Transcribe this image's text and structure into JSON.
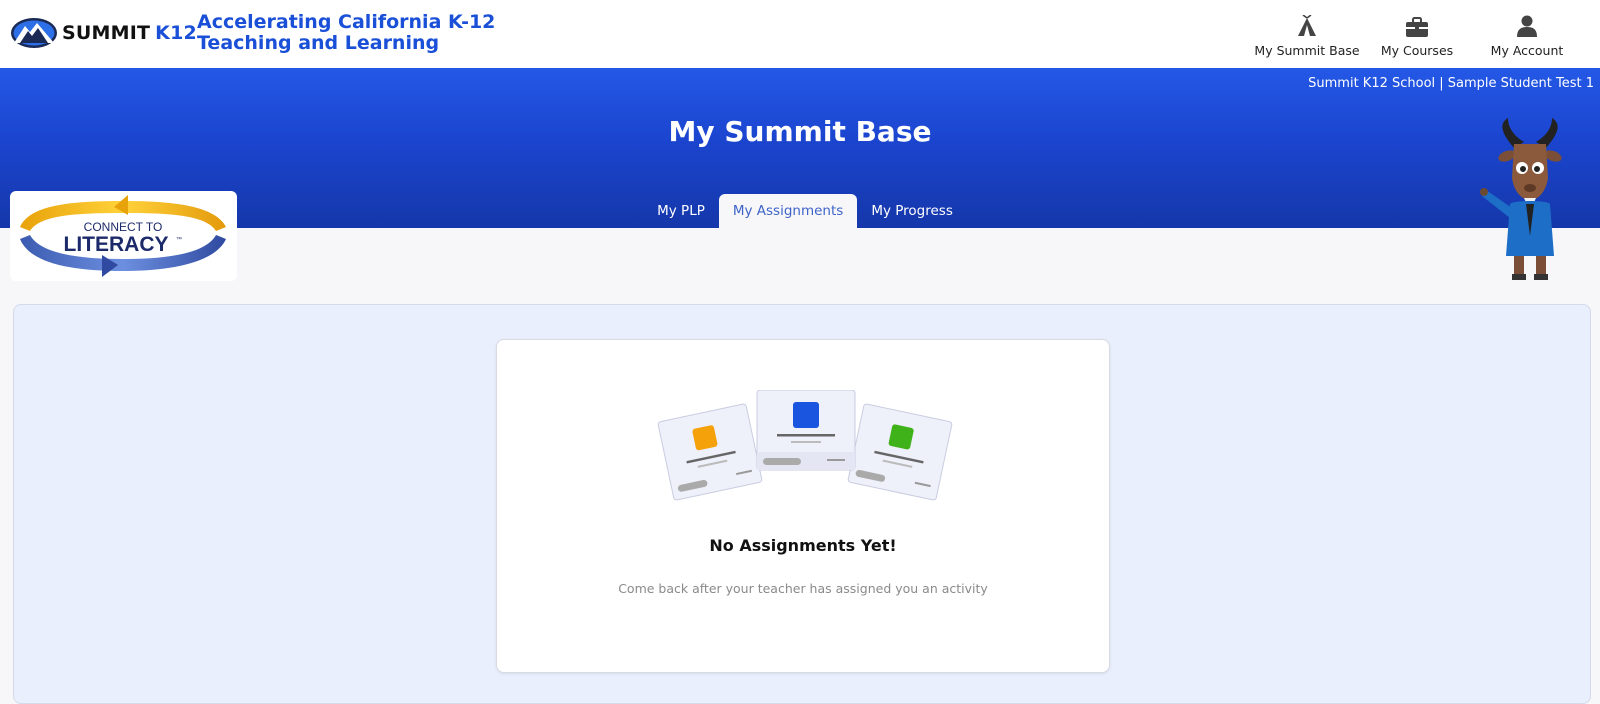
{
  "brand": {
    "name": "SUMMIT",
    "suffix": "K12",
    "tagline_line1": "Accelerating California K-12",
    "tagline_line2": "Teaching and Learning",
    "icon": "mountain-logo-icon"
  },
  "topnav": {
    "items": [
      {
        "label": "My Summit Base",
        "icon": "tent-icon"
      },
      {
        "label": "My Courses",
        "icon": "briefcase-icon"
      },
      {
        "label": "My Account",
        "icon": "user-icon"
      }
    ]
  },
  "banner": {
    "school_line": "Summit K12 School | Sample Student Test 1",
    "page_title": "My Summit Base"
  },
  "tabs": [
    {
      "label": "My PLP",
      "active": false
    },
    {
      "label": "My Assignments",
      "active": true
    },
    {
      "label": "My Progress",
      "active": false
    }
  ],
  "literacy_logo": {
    "line1": "CONNECT TO",
    "line2": "LITERACY",
    "tm": "™"
  },
  "empty_state": {
    "title": "No Assignments Yet!",
    "subtitle": "Come back after your teacher has assigned you an activity"
  },
  "colors": {
    "brand_blue": "#1a4fd8",
    "banner_top": "#2458e6",
    "banner_bottom": "#1537aa",
    "active_tab_text": "#3e64c9",
    "panel_bg": "#eaeffd"
  }
}
